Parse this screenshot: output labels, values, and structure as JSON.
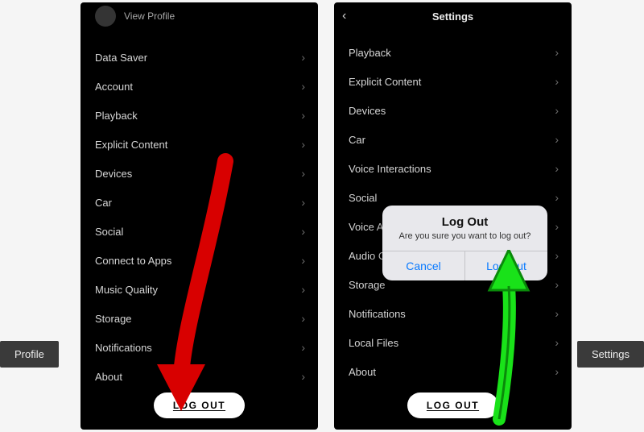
{
  "left": {
    "header": {
      "view_profile": "View Profile"
    },
    "items": [
      {
        "label": "Data Saver"
      },
      {
        "label": "Account"
      },
      {
        "label": "Playback"
      },
      {
        "label": "Explicit Content"
      },
      {
        "label": "Devices"
      },
      {
        "label": "Car"
      },
      {
        "label": "Social"
      },
      {
        "label": "Connect to Apps"
      },
      {
        "label": "Music Quality"
      },
      {
        "label": "Storage"
      },
      {
        "label": "Notifications"
      },
      {
        "label": "About"
      }
    ],
    "logout": "LOG OUT"
  },
  "right": {
    "title": "Settings",
    "items": [
      {
        "label": "Playback"
      },
      {
        "label": "Explicit Content"
      },
      {
        "label": "Devices"
      },
      {
        "label": "Car"
      },
      {
        "label": "Voice Interactions"
      },
      {
        "label": "Social"
      },
      {
        "label": "Voice A"
      },
      {
        "label": "Audio C"
      },
      {
        "label": "Storage"
      },
      {
        "label": "Notifications"
      },
      {
        "label": "Local Files"
      },
      {
        "label": "About"
      }
    ],
    "logout": "LOG OUT",
    "dialog": {
      "title": "Log Out",
      "message": "Are you sure you want to log out?",
      "cancel": "Cancel",
      "confirm": "Log Out"
    }
  },
  "captions": {
    "profile": "Profile",
    "settings": "Settings"
  }
}
